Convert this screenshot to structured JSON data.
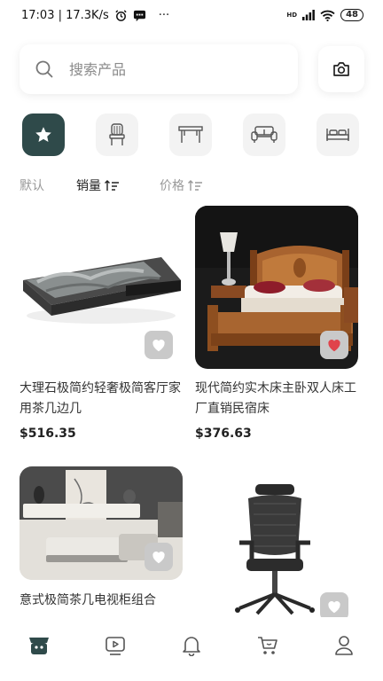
{
  "status_bar": {
    "time_and_speed": "17:03 | 17.3K/s",
    "more": "···",
    "network": "HD",
    "battery": "48"
  },
  "search": {
    "placeholder": "搜索产品"
  },
  "categories": [
    {
      "icon": "star-icon",
      "active": true
    },
    {
      "icon": "chair-icon",
      "active": false
    },
    {
      "icon": "table-icon",
      "active": false
    },
    {
      "icon": "sofa-icon",
      "active": false
    },
    {
      "icon": "bed-icon",
      "active": false
    }
  ],
  "sort_tabs": [
    {
      "label": "默认",
      "active": false
    },
    {
      "label": "销量",
      "active": true
    },
    {
      "label": "价格",
      "active": false
    }
  ],
  "products": [
    {
      "name": "大理石极简约轻奢极简客厅家用茶几边几",
      "price": "$516.35",
      "favorited": false
    },
    {
      "name": "现代简约实木床主卧双人床工厂直销民宿床",
      "price": "$376.63",
      "favorited": true
    },
    {
      "name": "意式极简茶几电视柜组合",
      "price": "",
      "favorited": false
    },
    {
      "name": "",
      "price": "",
      "favorited": false
    }
  ],
  "bottom_nav": [
    {
      "icon": "store-icon",
      "active": true
    },
    {
      "icon": "video-icon",
      "active": false
    },
    {
      "icon": "bell-icon",
      "active": false
    },
    {
      "icon": "cart-icon",
      "active": false
    },
    {
      "icon": "profile-icon",
      "active": false
    }
  ],
  "colors": {
    "accent": "#2f4a4a",
    "favorite": "#e0434b",
    "heart_bg": "#c9c9c9"
  }
}
